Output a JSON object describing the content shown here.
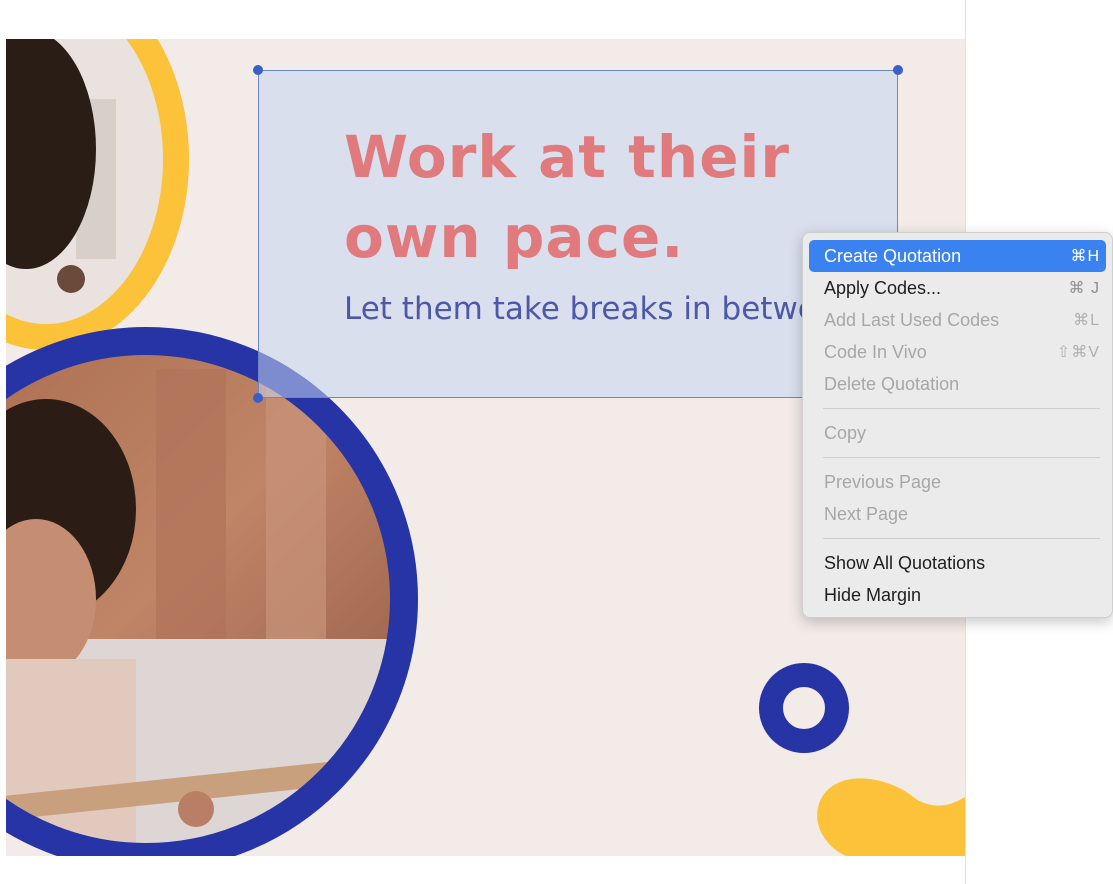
{
  "document": {
    "headline_line1": "Work at their",
    "headline_line2": "own pace.",
    "subline": "Let them take breaks in between."
  },
  "colors": {
    "page_background": "#f2ebe8",
    "headline": "#e07a7c",
    "subline": "#4e58a8",
    "yellow_accent": "#fcc23a",
    "blue_accent": "#2634a6",
    "selection_fill": "#c4d6f0",
    "menu_highlight": "#3b82f1"
  },
  "context_menu": {
    "items": [
      {
        "label": "Create Quotation",
        "shortcut": "⌘H",
        "state": "highlighted"
      },
      {
        "label": "Apply Codes...",
        "shortcut": "⌘ J",
        "state": "enabled"
      },
      {
        "label": "Add Last Used Codes",
        "shortcut": "⌘L",
        "state": "disabled"
      },
      {
        "label": "Code In Vivo",
        "shortcut": "⇧⌘V",
        "state": "disabled"
      },
      {
        "label": "Delete Quotation",
        "shortcut": "",
        "state": "disabled"
      },
      {
        "label": "Copy",
        "shortcut": "",
        "state": "disabled"
      },
      {
        "label": "Previous Page",
        "shortcut": "",
        "state": "disabled"
      },
      {
        "label": "Next Page",
        "shortcut": "",
        "state": "disabled"
      },
      {
        "label": "Show All Quotations",
        "shortcut": "",
        "state": "enabled"
      },
      {
        "label": "Hide Margin",
        "shortcut": "",
        "state": "enabled"
      }
    ]
  }
}
